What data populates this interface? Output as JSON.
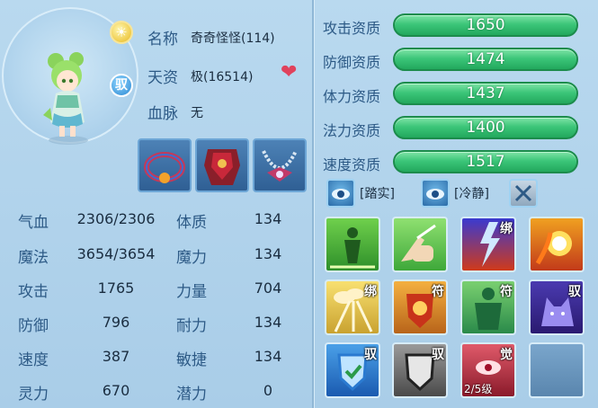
{
  "pet": {
    "name_label": "名称",
    "name_value": "奇奇怪怪(114)",
    "talent_label": "天资",
    "talent_value": "极(16514)",
    "bloodline_label": "血脉",
    "bloodline_value": "无",
    "ride_badge": "驭",
    "portrait_icon": "pet-portrait-icon",
    "heart_icon": "heart-icon",
    "sun_icon": "sun-badge-icon"
  },
  "equipment": [
    {
      "icon": "collar-equipment-icon"
    },
    {
      "icon": "armor-equipment-icon"
    },
    {
      "icon": "necklace-equipment-icon"
    }
  ],
  "stats": [
    {
      "label": "气血",
      "value": "2306/2306",
      "label2": "体质",
      "value2": "134"
    },
    {
      "label": "魔法",
      "value": "3654/3654",
      "label2": "魔力",
      "value2": "134"
    },
    {
      "label": "攻击",
      "value": "1765",
      "label2": "力量",
      "value2": "704"
    },
    {
      "label": "防御",
      "value": "796",
      "label2": "耐力",
      "value2": "134"
    },
    {
      "label": "速度",
      "value": "387",
      "label2": "敏捷",
      "value2": "134"
    },
    {
      "label": "灵力",
      "value": "670",
      "label2": "潜力",
      "value2": "0"
    }
  ],
  "aptitudes": [
    {
      "label": "攻击资质",
      "value": "1650"
    },
    {
      "label": "防御资质",
      "value": "1474"
    },
    {
      "label": "体力资质",
      "value": "1437"
    },
    {
      "label": "法力资质",
      "value": "1400"
    },
    {
      "label": "速度资质",
      "value": "1517"
    }
  ],
  "traits": [
    {
      "icon": "eye-trait-icon",
      "label": "[踏实]"
    },
    {
      "icon": "eye-trait-icon",
      "label": "[冷静]"
    },
    {
      "icon": "crossed-arrows-icon",
      "label": ""
    }
  ],
  "skills": [
    {
      "icon": "green-figure-skill-icon",
      "tag": "",
      "level": ""
    },
    {
      "icon": "pointing-hand-skill-icon",
      "tag": "",
      "level": ""
    },
    {
      "icon": "lightning-skill-icon",
      "tag": "绑",
      "level": ""
    },
    {
      "icon": "fireball-skill-icon",
      "tag": "",
      "level": ""
    },
    {
      "icon": "cloud-skill-icon",
      "tag": "绑",
      "level": ""
    },
    {
      "icon": "shield-badge-skill-icon",
      "tag": "符",
      "level": ""
    },
    {
      "icon": "green-body-skill-icon",
      "tag": "符",
      "level": ""
    },
    {
      "icon": "wolf-skill-icon",
      "tag": "驭",
      "level": ""
    },
    {
      "icon": "blue-shield-skill-icon",
      "tag": "驭",
      "level": ""
    },
    {
      "icon": "gray-shield-skill-icon",
      "tag": "驭",
      "level": ""
    },
    {
      "icon": "red-eye-skill-icon",
      "tag": "觉",
      "level": "2/5级"
    },
    {
      "icon": "empty-skill-slot",
      "tag": "",
      "level": ""
    }
  ]
}
